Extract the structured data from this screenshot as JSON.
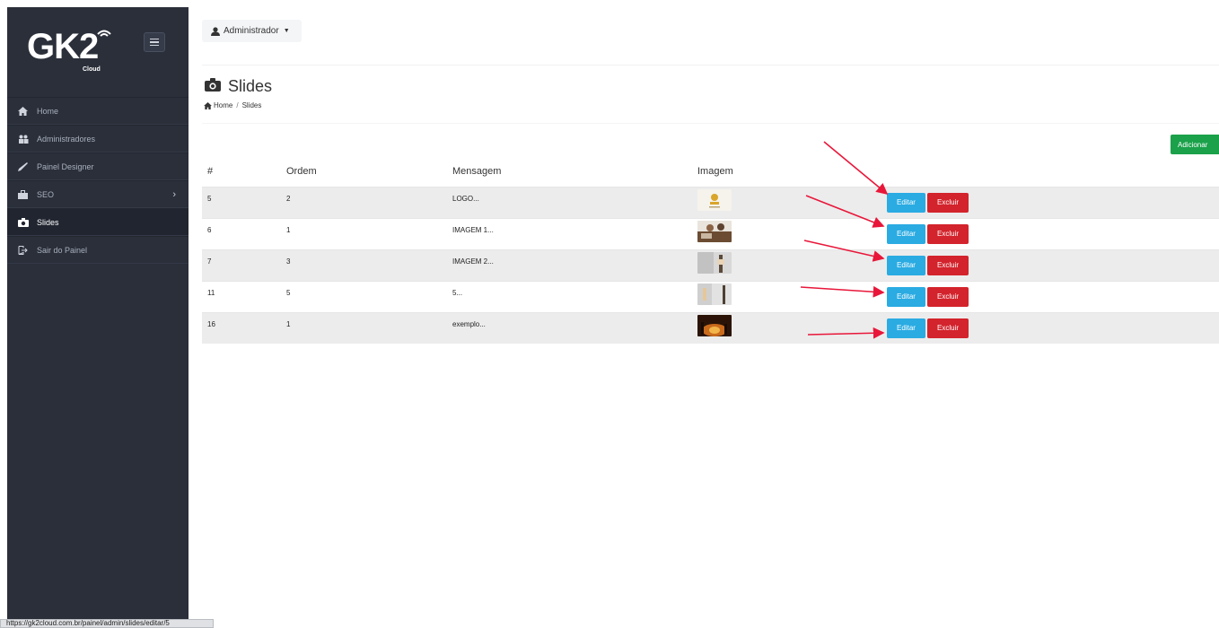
{
  "brand": {
    "logo_text": "GK2",
    "logo_sub": "Cloud"
  },
  "sidebar": {
    "items": [
      {
        "label": "Home",
        "icon": "home-icon"
      },
      {
        "label": "Administradores",
        "icon": "users-icon"
      },
      {
        "label": "Painel Designer",
        "icon": "brush-icon"
      },
      {
        "label": "SEO",
        "icon": "briefcase-icon"
      },
      {
        "label": "Slides",
        "icon": "camera-icon"
      },
      {
        "label": "Sair do Painel",
        "icon": "logout-icon"
      }
    ],
    "active": "Slides"
  },
  "topbar": {
    "user_label": "Administrador"
  },
  "page": {
    "title": "Slides",
    "breadcrumb": [
      "Home",
      "Slides"
    ],
    "add_label": "Adicionar"
  },
  "table": {
    "headers": [
      "#",
      "Ordem",
      "Mensagem",
      "Imagem"
    ],
    "rows": [
      {
        "id": "5",
        "ordem": "2",
        "mensagem": "LOGO...",
        "thumb_color": "#f3efe6"
      },
      {
        "id": "6",
        "ordem": "1",
        "mensagem": "IMAGEM 1...",
        "thumb_color": "#8a6a4a"
      },
      {
        "id": "7",
        "ordem": "3",
        "mensagem": "IMAGEM 2...",
        "thumb_color": "#cfcfcf"
      },
      {
        "id": "11",
        "ordem": "5",
        "mensagem": "5...",
        "thumb_color": "#d6d6d6"
      },
      {
        "id": "16",
        "ordem": "1",
        "mensagem": "exemplo...",
        "thumb_color": "#7a3a10"
      }
    ],
    "edit_label": "Editar",
    "delete_label": "Excluir"
  },
  "status_bar": {
    "url": "https://gk2cloud.com.br/painel/admin/slides/editar/5"
  },
  "colors": {
    "sidebar_bg": "#2a2f3a",
    "edit": "#2aabe2",
    "delete": "#d3232c",
    "add": "#1aa14a",
    "annotation_arrow": "#e8173a"
  }
}
